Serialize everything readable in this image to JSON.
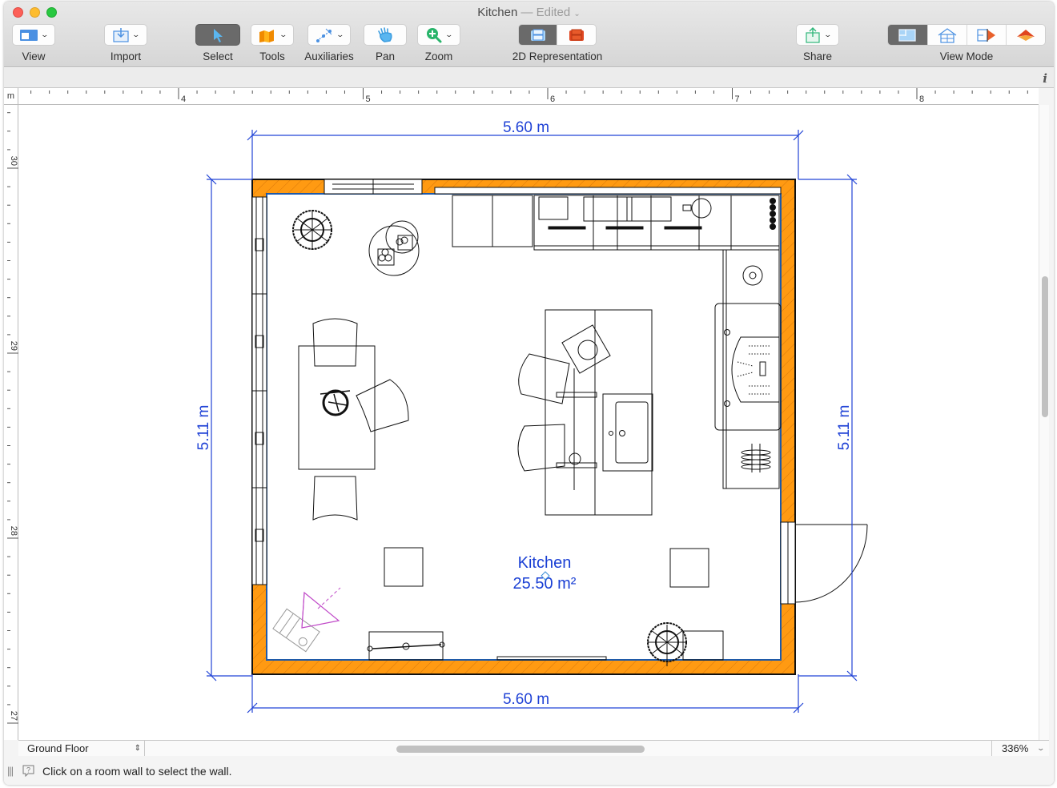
{
  "window": {
    "title": "Kitchen",
    "title_status": "— Edited",
    "traffic_lights": [
      "close",
      "minimize",
      "maximize"
    ]
  },
  "toolbar": {
    "items": [
      {
        "id": "view",
        "label": "View",
        "icon": "view-layout-icon",
        "has_menu": true
      },
      {
        "id": "import",
        "label": "Import",
        "icon": "import-icon",
        "has_menu": true
      },
      {
        "id": "select",
        "label": "Select",
        "icon": "cursor-arrow-icon",
        "has_menu": false,
        "active": true
      },
      {
        "id": "tools",
        "label": "Tools",
        "icon": "wall-tools-icon",
        "has_menu": true
      },
      {
        "id": "auxiliaries",
        "label": "Auxiliaries",
        "icon": "auxiliaries-icon",
        "has_menu": true
      },
      {
        "id": "pan",
        "label": "Pan",
        "icon": "hand-icon",
        "has_menu": false
      },
      {
        "id": "zoom",
        "label": "Zoom",
        "icon": "zoom-in-icon",
        "has_menu": true
      }
    ],
    "representation": {
      "label": "2D Representation",
      "options": [
        {
          "id": "blueprint",
          "icon": "chair-blueprint-icon",
          "active": true
        },
        {
          "id": "colored",
          "icon": "chair-colored-icon",
          "active": false
        }
      ]
    },
    "share": {
      "label": "Share",
      "icon": "share-icon",
      "has_menu": true
    },
    "view_mode": {
      "label": "View Mode",
      "options": [
        {
          "id": "floor-plan",
          "icon": "floor-plan-icon",
          "active": true
        },
        {
          "id": "elevation",
          "icon": "house-outline-icon",
          "active": false
        },
        {
          "id": "split",
          "icon": "split-view-icon",
          "active": false
        },
        {
          "id": "3d",
          "icon": "house-3d-icon",
          "active": false
        }
      ]
    }
  },
  "info_button": "i",
  "rulers": {
    "unit": "m",
    "horizontal_labels": [
      "4",
      "5",
      "6",
      "7",
      "8"
    ],
    "vertical_labels": [
      "30",
      "29",
      "28",
      "27"
    ]
  },
  "plan": {
    "room_name": "Kitchen",
    "room_area": "25.50 m²",
    "dimensions": {
      "top": "5.60 m",
      "bottom": "5.60 m",
      "left": "5.11 m",
      "right": "5.11 m"
    },
    "colors": {
      "wall_fill": "#ff9a12",
      "dimension_line": "#2143d6",
      "room_border": "#1f5aa8",
      "camera": "#c04ac8"
    }
  },
  "bottom": {
    "level": "Ground Floor",
    "zoom": "336%"
  },
  "status": {
    "message": "Click on a room wall to select the wall."
  }
}
